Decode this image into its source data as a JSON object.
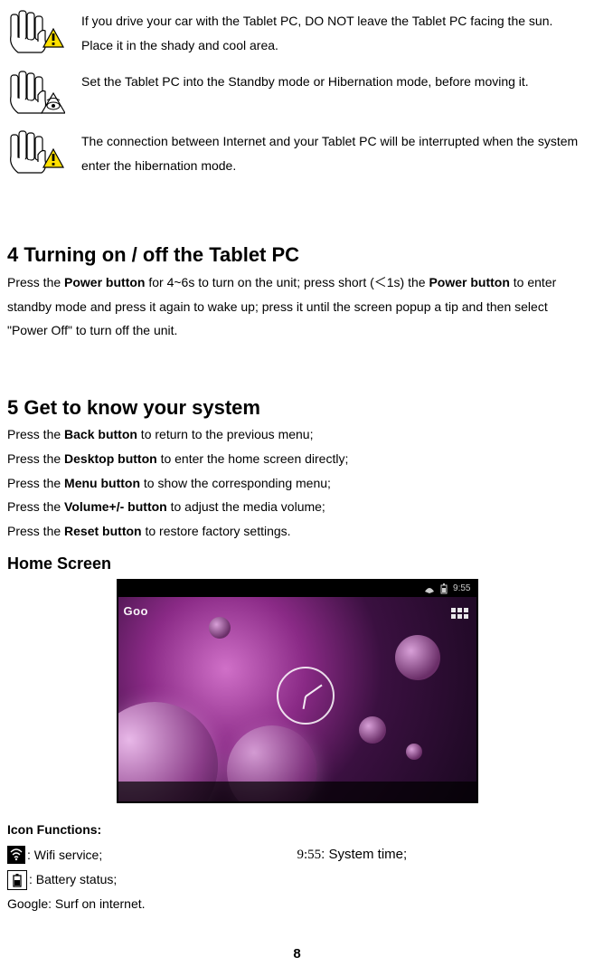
{
  "cautions": [
    {
      "text": "If you drive your car with the Tablet PC, DO NOT leave the Tablet PC facing the sun. Place it in the shady and cool area.",
      "variant": "warn"
    },
    {
      "text": "Set the Tablet PC into the Standby mode or Hibernation mode, before moving it.",
      "variant": "eye"
    },
    {
      "text": "The connection between Internet and your Tablet PC will be interrupted when the system enter the hibernation mode.",
      "variant": "warn"
    }
  ],
  "section4": {
    "title": "4 Turning on / off the Tablet PC",
    "prefix1": "Press the ",
    "bold1": "Power button",
    "mid1": " for 4~6s to turn on the unit; press short (＜1s) the ",
    "bold2": "Power button",
    "suffix1": " to enter standby mode and press it again to wake up; press it until the screen popup a tip and then select \"Power Off\" to turn off the unit."
  },
  "section5": {
    "title": "5 Get to know your system",
    "lines": [
      {
        "pre": "Press the ",
        "bold": "Back button",
        "post": " to return to the previous menu;"
      },
      {
        "pre": "Press the ",
        "bold": "Desktop button",
        "post": " to enter the home screen directly;"
      },
      {
        "pre": "Press the ",
        "bold": "Menu button",
        "post": " to show the corresponding menu;"
      },
      {
        "pre": "Press the ",
        "bold": "Volume+/- button",
        "post": " to adjust the media volume;"
      },
      {
        "pre": "Press the ",
        "bold": "Reset button",
        "post": " to restore factory settings."
      }
    ]
  },
  "home_screen": {
    "title": "Home Screen",
    "status_time": "9:55",
    "google_label": "Goo"
  },
  "icon_functions": {
    "title": "Icon Functions:",
    "wifi": ": Wifi service;",
    "systime_prefix": "9:55",
    "systime_post": ": System time;",
    "battery": ": Battery status;",
    "google": "Google: Surf on internet."
  },
  "page_number": "8"
}
